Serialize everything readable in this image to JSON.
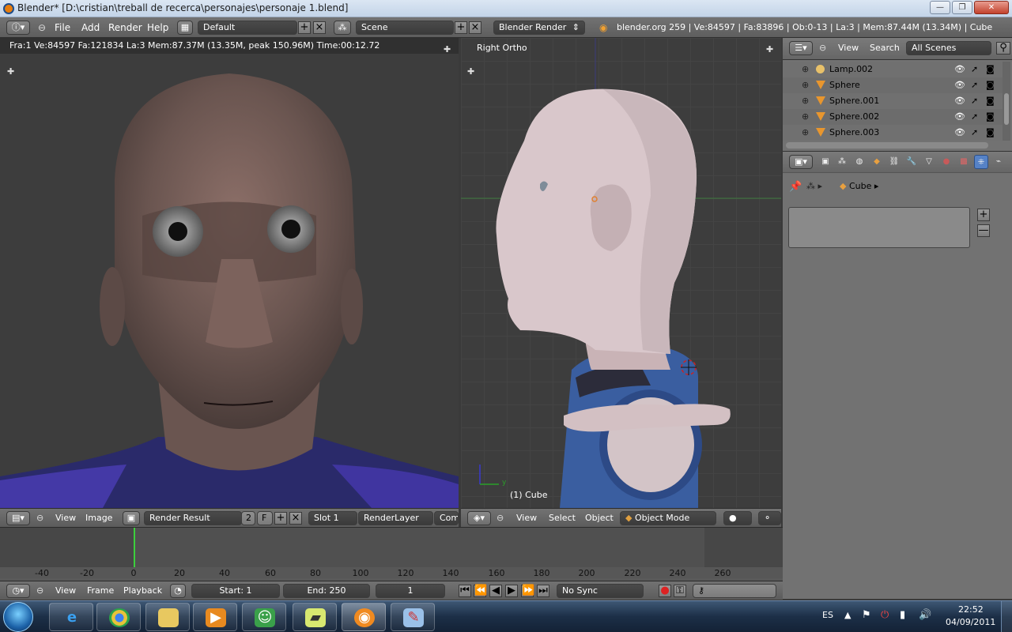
{
  "window": {
    "title": "Blender* [D:\\cristian\\treball de recerca\\personajes\\personaje 1.blend]",
    "controls": {
      "minimize": "—",
      "maximize": "❐",
      "close": "✕"
    }
  },
  "header": {
    "menus": [
      "File",
      "Add",
      "Render",
      "Help"
    ],
    "layout": "Default",
    "scene": "Scene",
    "engine": "Blender Render",
    "stats": "blender.org 259 | Ve:84597 | Fa:83896 | Ob:0-13 | La:3 | Mem:87.44M (13.34M) | Cube"
  },
  "left_view": {
    "info": "Fra:1  Ve:84597 Fa:121834 La:3 Mem:87.37M (13.35M, peak 150.96M) Time:00:12.72",
    "header": {
      "view": "View",
      "image": "Image",
      "image_name": "Render Result",
      "users": "2",
      "fake": "F",
      "slot": "Slot 1",
      "layer": "RenderLayer",
      "composite": "Comp"
    }
  },
  "right_view": {
    "label": "Right Ortho",
    "object": "(1) Cube",
    "header": {
      "view": "View",
      "select": "Select",
      "object": "Object",
      "mode": "Object Mode"
    }
  },
  "outliner": {
    "view": "View",
    "search": "Search",
    "scenes": "All Scenes",
    "items": [
      {
        "name": "Lamp.002",
        "type": "lamp"
      },
      {
        "name": "Sphere",
        "type": "mesh"
      },
      {
        "name": "Sphere.001",
        "type": "mesh"
      },
      {
        "name": "Sphere.002",
        "type": "mesh"
      },
      {
        "name": "Sphere.003",
        "type": "mesh"
      }
    ]
  },
  "properties": {
    "context": "Cube",
    "add": "+",
    "remove": "—"
  },
  "timeline": {
    "ticks": [
      "-40",
      "-20",
      "0",
      "20",
      "40",
      "60",
      "80",
      "100",
      "120",
      "140",
      "160",
      "180",
      "200",
      "220",
      "240",
      "260"
    ],
    "view": "View",
    "frame": "Frame",
    "playback": "Playback",
    "start": "Start: 1",
    "end": "End: 250",
    "current": "1",
    "sync": "No Sync"
  },
  "taskbar": {
    "language": "ES",
    "time": "22:52",
    "date": "04/09/2011"
  },
  "colors": {
    "blender_header": "#727272",
    "viewport_bg": "#3d3d3d",
    "active_tab": "#5682c6",
    "frame_marker": "#3ccf3c"
  }
}
